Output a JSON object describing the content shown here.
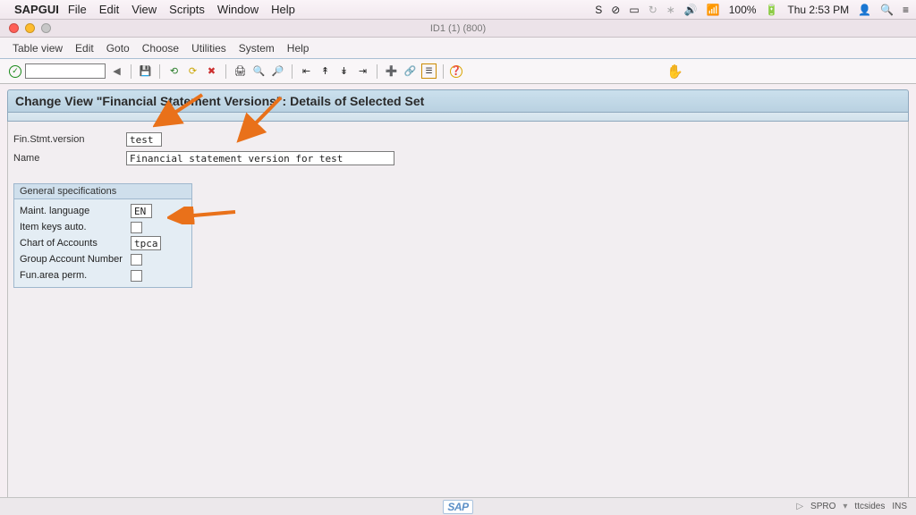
{
  "macmenu": {
    "app": "SAPGUI",
    "items": [
      "File",
      "Edit",
      "View",
      "Scripts",
      "Window",
      "Help"
    ],
    "battery": "100%",
    "clock": "Thu 2:53 PM"
  },
  "window": {
    "title": "ID1 (1) (800)"
  },
  "sapmenu": {
    "items": [
      "Table view",
      "Edit",
      "Goto",
      "Choose",
      "Utilities",
      "System",
      "Help"
    ]
  },
  "toolbar": {
    "check_icon": "✓",
    "back": "◀",
    "save": "💾",
    "left": "⟲",
    "right": "⟳",
    "cancel": "✖",
    "print": "🖨",
    "find": "🔍",
    "findnext": "🔎",
    "p_first": "⇤",
    "p_up": "↟",
    "p_down": "↡",
    "p_last": "⇥",
    "newsess": "➕",
    "shortcut": "🔗",
    "layout": "☰",
    "help": "❓",
    "hand": "✋"
  },
  "title": "Change View \"Financial Statement Versions\": Details of Selected Set",
  "fields": {
    "version_label": "Fin.Stmt.version",
    "version_value": "test",
    "name_label": "Name",
    "name_value": "Financial statement version for test"
  },
  "group": {
    "title": "General specifications",
    "lang_label": "Maint. language",
    "lang_value": "EN",
    "itemkeys_label": "Item keys auto.",
    "coa_label": "Chart of Accounts",
    "coa_value": "tpca",
    "gan_label": "Group Account Number",
    "fap_label": "Fun.area perm."
  },
  "status": {
    "breadcrumbs": "SPRO",
    "tcode": "ttcsides",
    "mode": "INS",
    "sap": "SAP"
  }
}
